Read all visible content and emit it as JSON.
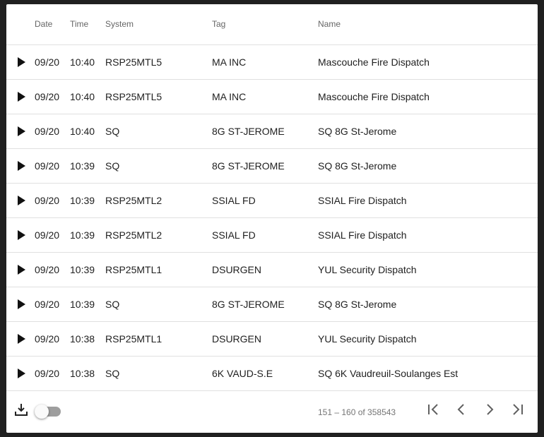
{
  "table": {
    "headers": {
      "date": "Date",
      "time": "Time",
      "system": "System",
      "tag": "Tag",
      "name": "Name"
    },
    "rows": [
      {
        "date": "09/20",
        "time": "10:40",
        "system": "RSP25MTL5",
        "tag": "MA INC",
        "name": "Mascouche Fire Dispatch"
      },
      {
        "date": "09/20",
        "time": "10:40",
        "system": "RSP25MTL5",
        "tag": "MA INC",
        "name": "Mascouche Fire Dispatch"
      },
      {
        "date": "09/20",
        "time": "10:40",
        "system": "SQ",
        "tag": "8G ST-JEROME",
        "name": "SQ 8G St-Jerome"
      },
      {
        "date": "09/20",
        "time": "10:39",
        "system": "SQ",
        "tag": "8G ST-JEROME",
        "name": "SQ 8G St-Jerome"
      },
      {
        "date": "09/20",
        "time": "10:39",
        "system": "RSP25MTL2",
        "tag": "SSIAL FD",
        "name": "SSIAL Fire Dispatch"
      },
      {
        "date": "09/20",
        "time": "10:39",
        "system": "RSP25MTL2",
        "tag": "SSIAL FD",
        "name": "SSIAL Fire Dispatch"
      },
      {
        "date": "09/20",
        "time": "10:39",
        "system": "RSP25MTL1",
        "tag": "DSURGEN",
        "name": "YUL Security Dispatch"
      },
      {
        "date": "09/20",
        "time": "10:39",
        "system": "SQ",
        "tag": "8G ST-JEROME",
        "name": "SQ 8G St-Jerome"
      },
      {
        "date": "09/20",
        "time": "10:38",
        "system": "RSP25MTL1",
        "tag": "DSURGEN",
        "name": "YUL Security Dispatch"
      },
      {
        "date": "09/20",
        "time": "10:38",
        "system": "SQ",
        "tag": "6K VAUD-S.E",
        "name": "SQ 6K Vaudreuil-Soulanges Est"
      }
    ]
  },
  "footer": {
    "download_icon": "download-icon",
    "toggle_state": "off",
    "range_label": "151 – 160 of 358543",
    "nav_icons": [
      "first-page-icon",
      "previous-page-icon",
      "next-page-icon",
      "last-page-icon"
    ]
  },
  "colors": {
    "background": "#202020",
    "card": "#ffffff",
    "divider": "#e0e0e0",
    "header_text": "#666666",
    "cell_text": "#212121",
    "icon": "#616161",
    "toggle_track": "#9e9e9e"
  }
}
